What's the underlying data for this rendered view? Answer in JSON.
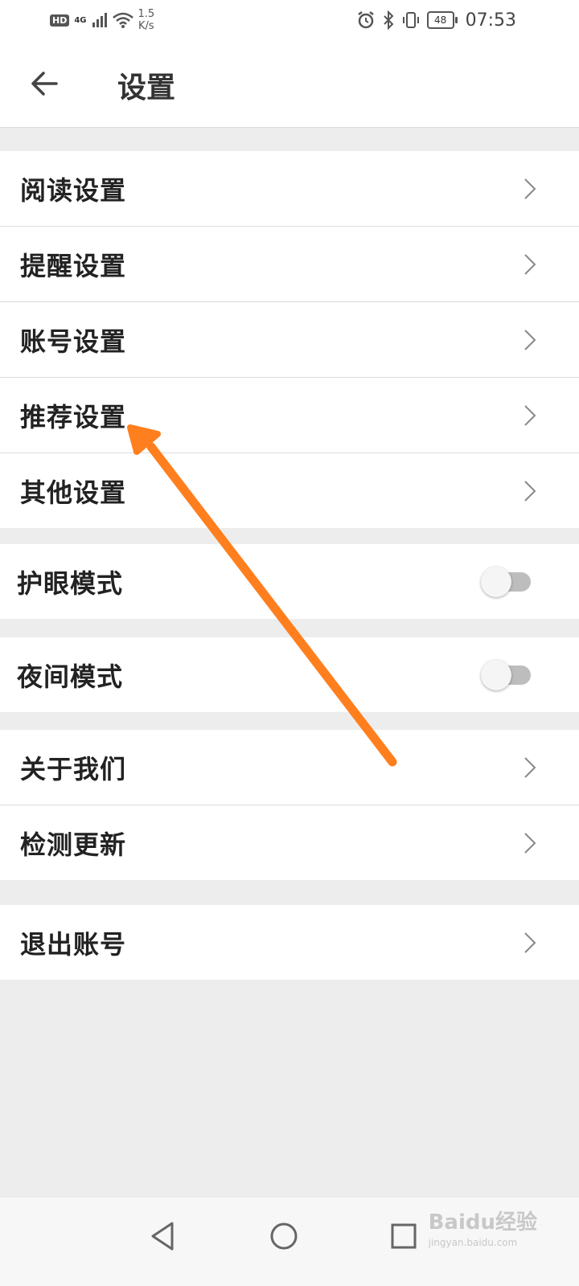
{
  "status_bar": {
    "hd": "HD",
    "network": "4G",
    "speed_value": "1.5",
    "speed_unit": "K/s",
    "battery": "48",
    "time": "07:53"
  },
  "header": {
    "title": "设置"
  },
  "groups": {
    "settings": [
      "阅读设置",
      "提醒设置",
      "账号设置",
      "推荐设置",
      "其他设置"
    ],
    "eye_mode": {
      "label": "护眼模式",
      "enabled": false
    },
    "night_mode": {
      "label": "夜间模式",
      "enabled": false
    },
    "about": [
      "关于我们",
      "检测更新"
    ],
    "logout": "退出账号"
  },
  "watermark": {
    "logo": "Baidu经验",
    "url": "jingyan.baidu.com"
  },
  "colors": {
    "annotation_arrow": "#ff7f1e",
    "toggle_off": "#bdbdbd"
  }
}
